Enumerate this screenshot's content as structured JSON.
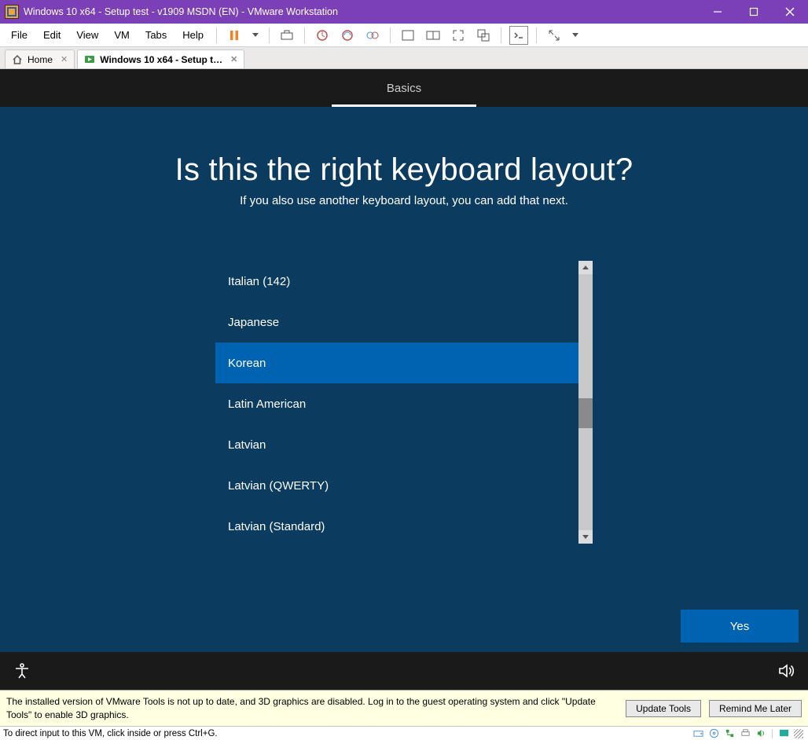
{
  "window": {
    "title": "Windows 10 x64 - Setup test - v1909 MSDN (EN) - VMware Workstation"
  },
  "menu": {
    "file": "File",
    "edit": "Edit",
    "view": "View",
    "vm": "VM",
    "tabs": "Tabs",
    "help": "Help"
  },
  "tabs": {
    "home": "Home",
    "vm": "Windows 10 x64 - Setup t…"
  },
  "oobe": {
    "tab": "Basics",
    "heading": "Is this the right keyboard layout?",
    "subheading": "If you also use another keyboard layout, you can add that next.",
    "layouts": [
      "Italian (142)",
      "Japanese",
      "Korean",
      "Latin American",
      "Latvian",
      "Latvian (QWERTY)",
      "Latvian (Standard)"
    ],
    "selected_index": 2,
    "yes": "Yes"
  },
  "toolsbar": {
    "msg": "The installed version of VMware Tools is not up to date, and 3D graphics are disabled. Log in to the guest operating system and click \"Update Tools\" to enable 3D graphics.",
    "update": "Update Tools",
    "remind": "Remind Me Later"
  },
  "status": {
    "msg": "To direct input to this VM, click inside or press Ctrl+G."
  }
}
